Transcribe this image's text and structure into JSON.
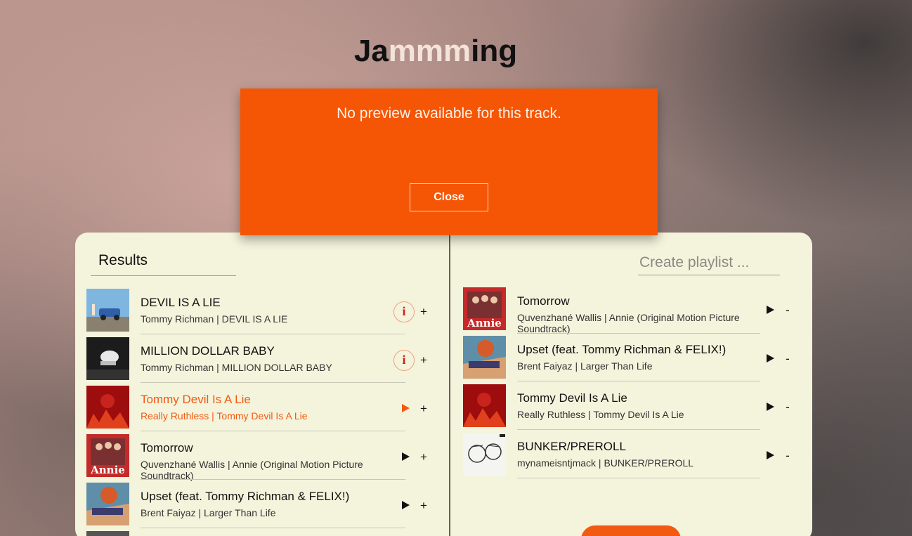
{
  "app": {
    "title_prefix": "Ja",
    "title_highlight": "mmm",
    "title_suffix": "ing"
  },
  "results": {
    "title": "Results",
    "tracks": [
      {
        "name": "DEVIL IS A LIE",
        "meta": "Tommy Richman | DEVIL IS A LIE",
        "action": "info",
        "add": "+"
      },
      {
        "name": "MILLION DOLLAR BABY",
        "meta": "Tommy Richman | MILLION DOLLAR BABY",
        "action": "info",
        "add": "+"
      },
      {
        "name": "Tommy Devil Is A Lie",
        "meta": "Really Ruthless | Tommy Devil Is A Lie",
        "action": "play",
        "add": "+"
      },
      {
        "name": "Tomorrow",
        "meta": "Quvenzhané Wallis | Annie (Original Motion Picture Soundtrack)",
        "action": "play",
        "add": "+"
      },
      {
        "name": "Upset (feat. Tommy Richman & FELIX!)",
        "meta": "Brent Faiyaz | Larger Than Life",
        "action": "play",
        "add": "+"
      }
    ]
  },
  "playlist": {
    "placeholder": "Create playlist ...",
    "tracks": [
      {
        "name": "Tomorrow",
        "meta": "Quvenzhané Wallis | Annie (Original Motion Picture Soundtrack)",
        "remove": "-"
      },
      {
        "name": "Upset (feat. Tommy Richman & FELIX!)",
        "meta": "Brent Faiyaz | Larger Than Life",
        "remove": "-"
      },
      {
        "name": "Tommy Devil Is A Lie",
        "meta": "Really Ruthless | Tommy Devil Is A Lie",
        "remove": "-"
      },
      {
        "name": "BUNKER/PREROLL",
        "meta": "mynameisntjmack | BUNKER/PREROLL",
        "remove": "-"
      }
    ]
  },
  "modal": {
    "message": "No preview available for this track.",
    "close_label": "Close"
  },
  "colors": {
    "accent": "#f55605",
    "panel": "#f4f3dc",
    "active_text": "#f25a12"
  }
}
